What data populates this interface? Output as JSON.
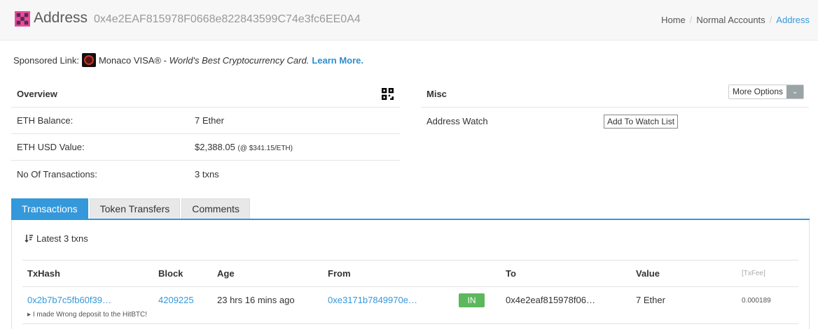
{
  "header": {
    "title": "Address",
    "address": "0x4e2EAF815978F0668e822843599C74e3fc6EE0A4",
    "breadcrumb": [
      "Home",
      "Normal Accounts",
      "Address"
    ]
  },
  "sponsored": {
    "prefix": "Sponsored Link:",
    "brand": "Monaco VISA® -",
    "tagline": "World's Best Cryptocurrency Card.",
    "cta": "Learn More."
  },
  "overview": {
    "heading": "Overview",
    "rows": [
      {
        "label": "ETH Balance:",
        "value": "7 Ether",
        "extra": ""
      },
      {
        "label": "ETH USD Value:",
        "value": "$2,388.05",
        "extra": "(@ $341.15/ETH)"
      },
      {
        "label": "No Of Transactions:",
        "value": "3 txns",
        "extra": ""
      }
    ]
  },
  "misc": {
    "heading": "Misc",
    "more_options": "More Options",
    "watch_label": "Address Watch",
    "watch_button": "Add To Watch List"
  },
  "tabs": [
    "Transactions",
    "Token Transfers",
    "Comments"
  ],
  "transactions": {
    "summary": "Latest 3 txns",
    "columns": [
      "TxHash",
      "Block",
      "Age",
      "From",
      "To",
      "Value",
      "[TxFee]"
    ],
    "rows": [
      {
        "hash": "0x2b7b7c5fb60f39…",
        "block": "4209225",
        "age": "23 hrs 16 mins ago",
        "from": "0xe3171b7849970e…",
        "direction": "IN",
        "to": "0x4e2eaf815978f06…",
        "value": "7 Ether",
        "fee": "0.000189",
        "note": "I made Wrong deposit to the HitBTC!"
      }
    ]
  },
  "colors": {
    "accent": "#3498db",
    "in_badge": "#5cb85c"
  }
}
